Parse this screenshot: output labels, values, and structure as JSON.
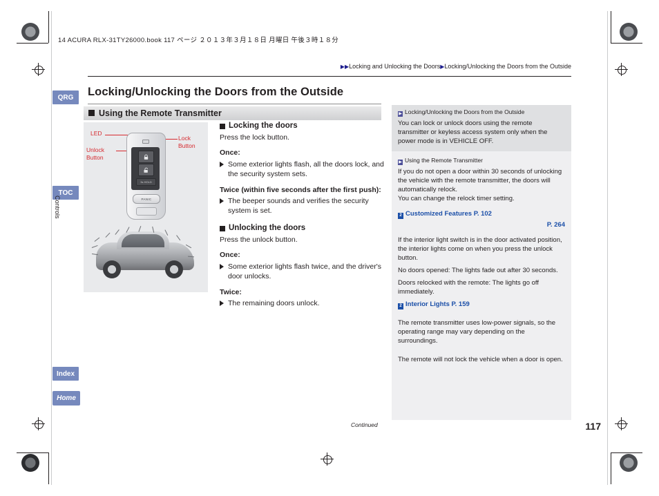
{
  "header": {
    "filestamp": "14 ACURA RLX-31TY26000.book   117 ページ   ２０１３年３月１８日   月曜日   午後３時１８分",
    "breadcrumb_1": "Locking and Unlocking the Doors",
    "breadcrumb_2": "Locking/Unlocking the Doors from the Outside",
    "title": "Locking/Unlocking the Doors from the Outside",
    "subhead": "Using the Remote Transmitter"
  },
  "tabs": {
    "qrg": "QRG",
    "toc": "TOC",
    "index": "Index",
    "home": "Home",
    "side_label": "Controls"
  },
  "figure": {
    "label_led": "LED",
    "label_unlock": "Unlock\nButton",
    "label_lock": "Lock\nButton",
    "fob_hold_text": "3s HOLD",
    "fob_panic_text": "PANIC"
  },
  "main": {
    "section1_head": "Locking the doors",
    "section1_intro": "Press the lock button.",
    "once_label": "Once:",
    "once_text": "Some exterior lights flash, all the doors lock, and the security system sets.",
    "twice_label": "Twice (within five seconds after the first push):",
    "twice_text": "The beeper sounds and verifies the security system is set.",
    "section2_head": "Unlocking the doors",
    "section2_intro": "Press the unlock button.",
    "once2_label": "Once:",
    "once2_text": "Some exterior lights flash twice, and the driver's door unlocks.",
    "twice2_label": "Twice:",
    "twice2_text": "The remaining doors unlock."
  },
  "sidebar": {
    "note1_title": "Locking/Unlocking the Doors from the Outside",
    "note1_body": "You can lock or unlock doors using the remote transmitter or keyless access system only when the power mode is in VEHICLE OFF.",
    "note2_title": "Using the Remote Transmitter",
    "note2_p1": "If you do not open a door within 30 seconds of unlocking the vehicle with the remote transmitter, the doors will automatically relock.",
    "note2_p2": "You can change the relock timer setting.",
    "ref1_label": "Customized Features",
    "ref1_page": "P. 102",
    "ref1_page2": "P. 264",
    "note2_p3": "If the interior light switch is in the door activated position, the interior lights come on when you press the unlock button.",
    "note2_p4": "No doors opened: The lights fade out after 30 seconds.",
    "note2_p5": "Doors relocked with the remote: The lights go off immediately.",
    "ref2_label": "Interior Lights",
    "ref2_page": "P. 159",
    "note2_p6": "The remote transmitter uses low-power signals, so the operating range may vary depending on the surroundings.",
    "note2_p7": "The remote will not lock the vehicle when a door is open."
  },
  "footer": {
    "continued": "Continued",
    "page_number": "117"
  },
  "colors": {
    "tab_blue": "#7689bd",
    "callout_red": "#d6292e",
    "ref_blue": "#1b4fa8",
    "sidebar_bg": "#efeff1"
  }
}
